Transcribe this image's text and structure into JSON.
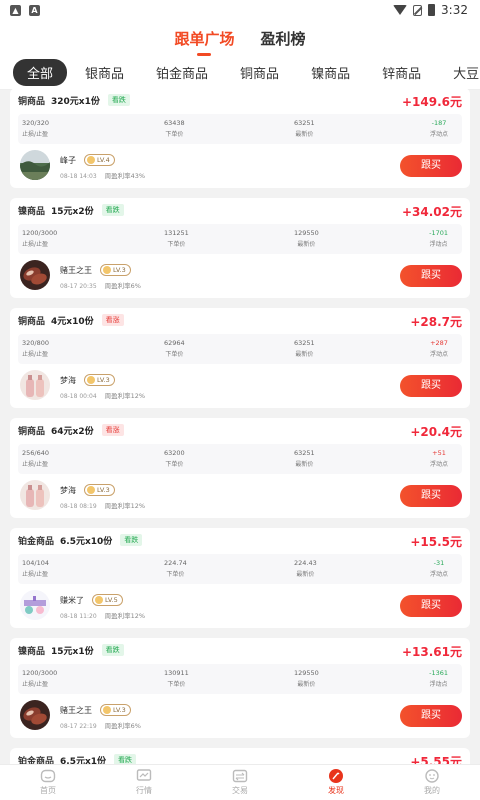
{
  "status": {
    "time": "3:32"
  },
  "header_tabs": [
    {
      "label": "跟单广场",
      "active": true
    },
    {
      "label": "盈利榜",
      "active": false
    }
  ],
  "categories": [
    "全部",
    "银商品",
    "铂金商品",
    "铜商品",
    "镍商品",
    "锌商品",
    "大豆"
  ],
  "stat_labels": [
    "止损/止盈",
    "下单价",
    "最新价",
    "浮动点"
  ],
  "follow_label": "跟买",
  "rate_prefix": "周盈利率",
  "cards": [
    {
      "product": "铜商品",
      "spec": "320元x1份",
      "tag": "看跌",
      "tag_type": "down",
      "profit": "+149.6元",
      "sl": "320/320",
      "order_price": "63438",
      "latest_price": "63251",
      "float": "-187",
      "float_type": "neg",
      "user": "峰子",
      "level": "LV.4",
      "time": "08-18 14:03",
      "rate": "43%",
      "avatar": "landscape"
    },
    {
      "product": "镍商品",
      "spec": "15元x2份",
      "tag": "看跌",
      "tag_type": "down",
      "profit": "+34.02元",
      "sl": "1200/3000",
      "order_price": "131251",
      "latest_price": "129550",
      "float": "-1701",
      "float_type": "neg",
      "user": "赌王之王",
      "level": "LV.3",
      "time": "08-17 20:35",
      "rate": "6%",
      "avatar": "food"
    },
    {
      "product": "铜商品",
      "spec": "4元x10份",
      "tag": "看涨",
      "tag_type": "up",
      "profit": "+28.7元",
      "sl": "320/800",
      "order_price": "62964",
      "latest_price": "63251",
      "float": "+287",
      "float_type": "pos",
      "user": "梦海",
      "level": "LV.3",
      "time": "08-18 00:04",
      "rate": "12%",
      "avatar": "bottles"
    },
    {
      "product": "铜商品",
      "spec": "64元x2份",
      "tag": "看涨",
      "tag_type": "up",
      "profit": "+20.4元",
      "sl": "256/640",
      "order_price": "63200",
      "latest_price": "63251",
      "float": "+51",
      "float_type": "pos",
      "user": "梦海",
      "level": "LV.3",
      "time": "08-18 08:19",
      "rate": "12%",
      "avatar": "bottles"
    },
    {
      "product": "铂金商品",
      "spec": "6.5元x10份",
      "tag": "看跌",
      "tag_type": "down",
      "profit": "+15.5元",
      "sl": "104/104",
      "order_price": "224.74",
      "latest_price": "224.43",
      "float": "-31",
      "float_type": "neg",
      "user": "赚米了",
      "level": "LV.5",
      "time": "08-18 11:20",
      "rate": "12%",
      "avatar": "party"
    },
    {
      "product": "镍商品",
      "spec": "15元x1份",
      "tag": "看跌",
      "tag_type": "down",
      "profit": "+13.61元",
      "sl": "1200/3000",
      "order_price": "130911",
      "latest_price": "129550",
      "float": "-1361",
      "float_type": "neg",
      "user": "赌王之王",
      "level": "LV.3",
      "time": "08-17 22:19",
      "rate": "6%",
      "avatar": "food"
    }
  ],
  "partial_card": {
    "product": "铂金商品",
    "spec": "6.5元x1份",
    "tag": "看跌",
    "profit": "+5.55元"
  },
  "tabbar": [
    {
      "label": "首页",
      "icon": "home-icon",
      "active": false
    },
    {
      "label": "行情",
      "icon": "chart-icon",
      "active": false
    },
    {
      "label": "交易",
      "icon": "trade-icon",
      "active": false
    },
    {
      "label": "发现",
      "icon": "discover-icon",
      "active": true
    },
    {
      "label": "我的",
      "icon": "user-icon",
      "active": false
    }
  ]
}
